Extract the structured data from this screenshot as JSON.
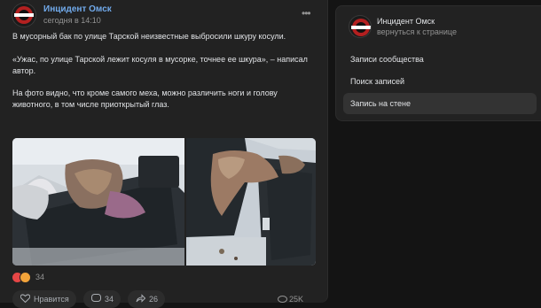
{
  "post": {
    "group_name": "Инцидент Омск",
    "time": "сегодня в 14:10",
    "paragraphs": [
      "В мусорный бак по улице Тарской неизвестные выбросили шкуру косули.",
      "«Ужас, по улице Тарской лежит косуля в мусорке, точнее ее шкура», – написал",
      "автор.",
      "На фото видно, что кроме самого меха, можно различить ноги и голову",
      "животного, в том числе приоткрытый глаз."
    ],
    "reactions_count": "34",
    "like_label": "Нравится",
    "comments_count": "34",
    "shares_count": "26",
    "views": "25K"
  },
  "panel": {
    "group_name": "Инцидент Омск",
    "back_label": "вернуться к странице",
    "menu": [
      {
        "label": "Записи сообщества",
        "active": false
      },
      {
        "label": "Поиск записей",
        "active": false
      },
      {
        "label": "Запись на стене",
        "active": true
      }
    ]
  },
  "colors": {
    "background": "#141414",
    "card": "#222222",
    "link": "#71aaeb",
    "brand_red": "#b32020"
  },
  "icons": [
    "more-icon",
    "heart-icon",
    "sad-icon",
    "like-icon",
    "comment-icon",
    "share-icon",
    "eye-icon"
  ]
}
